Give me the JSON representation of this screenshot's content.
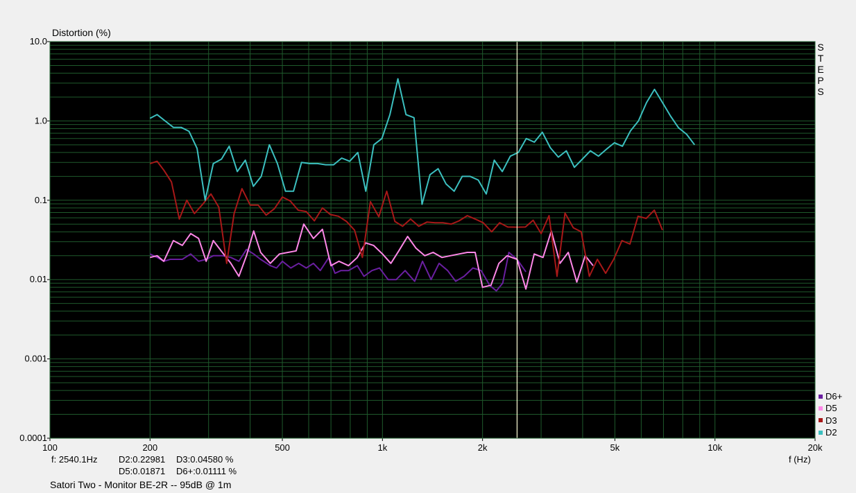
{
  "chart_data": {
    "type": "line",
    "ylabel": "Distortion (%)",
    "xlabel": "f (Hz)",
    "x_scale": "log",
    "y_scale": "log",
    "xlim": [
      100,
      20000
    ],
    "ylim": [
      0.0001,
      10.0
    ],
    "x_ticks": [
      {
        "v": 100,
        "label": "100"
      },
      {
        "v": 200,
        "label": "200"
      },
      {
        "v": 500,
        "label": "500"
      },
      {
        "v": 1000,
        "label": "1k"
      },
      {
        "v": 2000,
        "label": "2k"
      },
      {
        "v": 5000,
        "label": "5k"
      },
      {
        "v": 10000,
        "label": "10k"
      },
      {
        "v": 20000,
        "label": "20k"
      }
    ],
    "y_ticks": [
      {
        "v": 10,
        "label": "10.0"
      },
      {
        "v": 1,
        "label": "1.0"
      },
      {
        "v": 0.1,
        "label": "0.1"
      },
      {
        "v": 0.01,
        "label": "0.01"
      },
      {
        "v": 0.001,
        "label": "0.001"
      },
      {
        "v": 0.0001,
        "label": "0.0001"
      }
    ],
    "grid": true,
    "cursor_x": 2540.1,
    "legend_position": "bottom-right",
    "series": [
      {
        "name": "D6+",
        "color": "#6a1fa0",
        "points": [
          [
            200,
            0.021
          ],
          [
            210,
            0.019
          ],
          [
            220,
            0.017
          ],
          [
            230,
            0.018
          ],
          [
            240,
            0.018
          ],
          [
            250,
            0.018
          ],
          [
            265,
            0.021
          ],
          [
            280,
            0.017
          ],
          [
            295,
            0.018
          ],
          [
            310,
            0.02
          ],
          [
            330,
            0.02
          ],
          [
            350,
            0.019
          ],
          [
            370,
            0.017
          ],
          [
            390,
            0.024
          ],
          [
            410,
            0.021
          ],
          [
            430,
            0.018
          ],
          [
            460,
            0.015
          ],
          [
            480,
            0.014
          ],
          [
            500,
            0.017
          ],
          [
            530,
            0.014
          ],
          [
            560,
            0.016
          ],
          [
            590,
            0.014
          ],
          [
            620,
            0.016
          ],
          [
            650,
            0.013
          ],
          [
            690,
            0.019
          ],
          [
            720,
            0.012
          ],
          [
            750,
            0.013
          ],
          [
            790,
            0.013
          ],
          [
            840,
            0.015
          ],
          [
            880,
            0.011
          ],
          [
            930,
            0.013
          ],
          [
            980,
            0.014
          ],
          [
            1040,
            0.01
          ],
          [
            1100,
            0.01
          ],
          [
            1170,
            0.013
          ],
          [
            1250,
            0.0095
          ],
          [
            1320,
            0.017
          ],
          [
            1400,
            0.01
          ],
          [
            1480,
            0.016
          ],
          [
            1570,
            0.013
          ],
          [
            1660,
            0.0095
          ],
          [
            1760,
            0.011
          ],
          [
            1870,
            0.014
          ],
          [
            1980,
            0.013
          ],
          [
            2100,
            0.0085
          ],
          [
            2200,
            0.0072
          ],
          [
            2300,
            0.009
          ],
          [
            2400,
            0.022
          ],
          [
            2540,
            0.018
          ],
          [
            2700,
            0.0125
          ]
        ]
      },
      {
        "name": "D5",
        "color": "#ff88e8",
        "points": [
          [
            200,
            0.019
          ],
          [
            210,
            0.02
          ],
          [
            220,
            0.017
          ],
          [
            235,
            0.031
          ],
          [
            250,
            0.027
          ],
          [
            265,
            0.038
          ],
          [
            280,
            0.033
          ],
          [
            295,
            0.017
          ],
          [
            310,
            0.031
          ],
          [
            330,
            0.022
          ],
          [
            350,
            0.016
          ],
          [
            370,
            0.011
          ],
          [
            390,
            0.02
          ],
          [
            410,
            0.041
          ],
          [
            430,
            0.022
          ],
          [
            460,
            0.016
          ],
          [
            490,
            0.021
          ],
          [
            520,
            0.022
          ],
          [
            550,
            0.023
          ],
          [
            580,
            0.05
          ],
          [
            620,
            0.033
          ],
          [
            660,
            0.043
          ],
          [
            700,
            0.015
          ],
          [
            740,
            0.017
          ],
          [
            790,
            0.015
          ],
          [
            840,
            0.019
          ],
          [
            890,
            0.029
          ],
          [
            940,
            0.027
          ],
          [
            1000,
            0.021
          ],
          [
            1060,
            0.016
          ],
          [
            1120,
            0.023
          ],
          [
            1190,
            0.035
          ],
          [
            1260,
            0.025
          ],
          [
            1340,
            0.02
          ],
          [
            1420,
            0.022
          ],
          [
            1510,
            0.019
          ],
          [
            1600,
            0.02
          ],
          [
            1700,
            0.021
          ],
          [
            1800,
            0.022
          ],
          [
            1900,
            0.022
          ],
          [
            2000,
            0.008
          ],
          [
            2120,
            0.0085
          ],
          [
            2240,
            0.016
          ],
          [
            2370,
            0.02
          ],
          [
            2540,
            0.018
          ],
          [
            2700,
            0.0076
          ],
          [
            2860,
            0.021
          ],
          [
            3040,
            0.019
          ],
          [
            3220,
            0.041
          ],
          [
            3420,
            0.016
          ],
          [
            3620,
            0.022
          ],
          [
            3840,
            0.0093
          ],
          [
            4070,
            0.02
          ],
          [
            4300,
            0.015
          ]
        ]
      },
      {
        "name": "D3",
        "color": "#a81818",
        "points": [
          [
            200,
            0.29
          ],
          [
            210,
            0.31
          ],
          [
            220,
            0.24
          ],
          [
            232,
            0.17
          ],
          [
            245,
            0.058
          ],
          [
            258,
            0.1
          ],
          [
            272,
            0.068
          ],
          [
            288,
            0.089
          ],
          [
            305,
            0.12
          ],
          [
            322,
            0.082
          ],
          [
            340,
            0.016
          ],
          [
            358,
            0.068
          ],
          [
            378,
            0.14
          ],
          [
            400,
            0.087
          ],
          [
            423,
            0.087
          ],
          [
            447,
            0.065
          ],
          [
            473,
            0.078
          ],
          [
            500,
            0.11
          ],
          [
            528,
            0.098
          ],
          [
            558,
            0.075
          ],
          [
            590,
            0.072
          ],
          [
            624,
            0.055
          ],
          [
            660,
            0.08
          ],
          [
            697,
            0.066
          ],
          [
            737,
            0.063
          ],
          [
            780,
            0.054
          ],
          [
            824,
            0.042
          ],
          [
            870,
            0.019
          ],
          [
            920,
            0.096
          ],
          [
            975,
            0.062
          ],
          [
            1030,
            0.13
          ],
          [
            1090,
            0.054
          ],
          [
            1150,
            0.047
          ],
          [
            1215,
            0.058
          ],
          [
            1285,
            0.047
          ],
          [
            1360,
            0.053
          ],
          [
            1440,
            0.052
          ],
          [
            1520,
            0.052
          ],
          [
            1610,
            0.05
          ],
          [
            1700,
            0.055
          ],
          [
            1800,
            0.064
          ],
          [
            1900,
            0.058
          ],
          [
            2010,
            0.052
          ],
          [
            2130,
            0.04
          ],
          [
            2250,
            0.052
          ],
          [
            2380,
            0.046
          ],
          [
            2540,
            0.0458
          ],
          [
            2690,
            0.046
          ],
          [
            2840,
            0.056
          ],
          [
            3000,
            0.038
          ],
          [
            3170,
            0.064
          ],
          [
            3350,
            0.011
          ],
          [
            3540,
            0.069
          ],
          [
            3750,
            0.045
          ],
          [
            3960,
            0.04
          ],
          [
            4190,
            0.011
          ],
          [
            4430,
            0.018
          ],
          [
            4690,
            0.012
          ],
          [
            4960,
            0.018
          ],
          [
            5250,
            0.031
          ],
          [
            5550,
            0.028
          ],
          [
            5870,
            0.063
          ],
          [
            6210,
            0.059
          ],
          [
            6570,
            0.075
          ],
          [
            6950,
            0.042
          ]
        ]
      },
      {
        "name": "D2",
        "color": "#3cc0c0",
        "points": [
          [
            200,
            1.08
          ],
          [
            210,
            1.2
          ],
          [
            222,
            1.0
          ],
          [
            235,
            0.83
          ],
          [
            248,
            0.83
          ],
          [
            262,
            0.74
          ],
          [
            277,
            0.45
          ],
          [
            293,
            0.1
          ],
          [
            310,
            0.29
          ],
          [
            328,
            0.33
          ],
          [
            346,
            0.48
          ],
          [
            366,
            0.23
          ],
          [
            387,
            0.32
          ],
          [
            409,
            0.15
          ],
          [
            432,
            0.2
          ],
          [
            457,
            0.5
          ],
          [
            483,
            0.29
          ],
          [
            511,
            0.13
          ],
          [
            540,
            0.13
          ],
          [
            571,
            0.3
          ],
          [
            604,
            0.29
          ],
          [
            638,
            0.29
          ],
          [
            675,
            0.28
          ],
          [
            713,
            0.28
          ],
          [
            754,
            0.34
          ],
          [
            797,
            0.31
          ],
          [
            843,
            0.4
          ],
          [
            891,
            0.13
          ],
          [
            942,
            0.5
          ],
          [
            996,
            0.6
          ],
          [
            1053,
            1.2
          ],
          [
            1113,
            3.4
          ],
          [
            1177,
            1.2
          ],
          [
            1244,
            1.1
          ],
          [
            1315,
            0.089
          ],
          [
            1390,
            0.21
          ],
          [
            1470,
            0.25
          ],
          [
            1554,
            0.16
          ],
          [
            1643,
            0.13
          ],
          [
            1737,
            0.2
          ],
          [
            1836,
            0.2
          ],
          [
            1941,
            0.18
          ],
          [
            2052,
            0.12
          ],
          [
            2169,
            0.32
          ],
          [
            2293,
            0.23
          ],
          [
            2424,
            0.36
          ],
          [
            2562,
            0.4
          ],
          [
            2708,
            0.6
          ],
          [
            2862,
            0.54
          ],
          [
            3025,
            0.72
          ],
          [
            3197,
            0.46
          ],
          [
            3380,
            0.35
          ],
          [
            3573,
            0.42
          ],
          [
            3777,
            0.26
          ],
          [
            3992,
            0.33
          ],
          [
            4220,
            0.42
          ],
          [
            4461,
            0.36
          ],
          [
            4716,
            0.44
          ],
          [
            4985,
            0.53
          ],
          [
            5269,
            0.48
          ],
          [
            5570,
            0.75
          ],
          [
            5888,
            1.0
          ],
          [
            6224,
            1.7
          ],
          [
            6579,
            2.5
          ],
          [
            6955,
            1.7
          ],
          [
            7352,
            1.15
          ],
          [
            7771,
            0.82
          ],
          [
            8215,
            0.68
          ],
          [
            8683,
            0.5
          ]
        ]
      }
    ]
  },
  "steps_label": [
    "S",
    "T",
    "E",
    "P",
    "S"
  ],
  "legend": [
    {
      "name": "D6+",
      "color": "#6a1fa0"
    },
    {
      "name": "D5",
      "color": "#ff88e8"
    },
    {
      "name": "D3",
      "color": "#a81818"
    },
    {
      "name": "D2",
      "color": "#3cc0c0"
    }
  ],
  "readout": {
    "freq": "f: 2540.1Hz",
    "d2": "D2:0.22981",
    "d3": "D3:0.04580 %",
    "d5": "D5:0.01871",
    "d6": "D6+:0.01111 %"
  },
  "footer": "Satori Two - Monitor BE-2R -- 95dB @ 1m"
}
